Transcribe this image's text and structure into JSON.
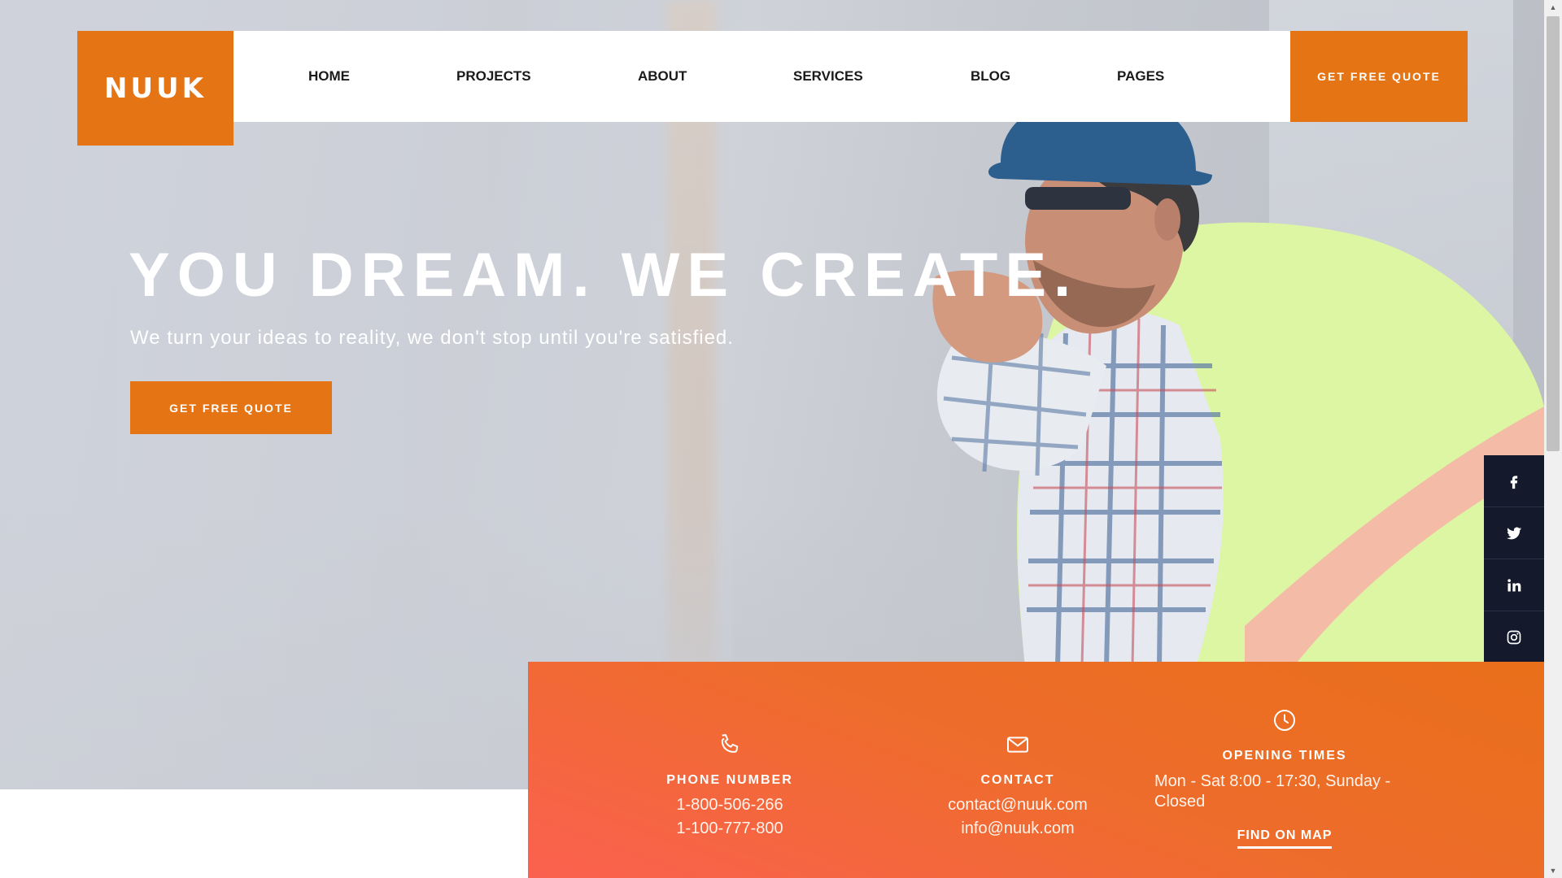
{
  "brand": {
    "logo_text": "NUUK",
    "accent_color": "#e57415"
  },
  "nav": {
    "items": [
      {
        "label": "HOME"
      },
      {
        "label": "PROJECTS"
      },
      {
        "label": "ABOUT"
      },
      {
        "label": "SERVICES"
      },
      {
        "label": "BLOG"
      },
      {
        "label": "PAGES"
      }
    ],
    "cta_label": "GET FREE QUOTE"
  },
  "hero": {
    "headline": "YOU DREAM. WE CREATE.",
    "subline": "We turn your ideas to reality, we don't stop until you're satisfied.",
    "cta_label": "GET FREE QUOTE"
  },
  "social": {
    "background": "#141a2c",
    "items": [
      {
        "icon": "facebook-icon"
      },
      {
        "icon": "twitter-icon"
      },
      {
        "icon": "linkedin-icon"
      },
      {
        "icon": "instagram-icon"
      }
    ]
  },
  "contact_band": {
    "phone": {
      "icon": "phone-icon",
      "title": "PHONE NUMBER",
      "lines": [
        "1-800-506-266",
        "1-100-777-800"
      ]
    },
    "contact": {
      "icon": "mail-icon",
      "title": "CONTACT",
      "lines": [
        "contact@nuuk.com",
        "info@nuuk.com"
      ]
    },
    "hours": {
      "icon": "clock-icon",
      "title": "OPENING TIMES",
      "text": "Mon - Sat 8:00 - 17:30, Sunday - Closed",
      "link_label": "FIND ON MAP"
    }
  }
}
